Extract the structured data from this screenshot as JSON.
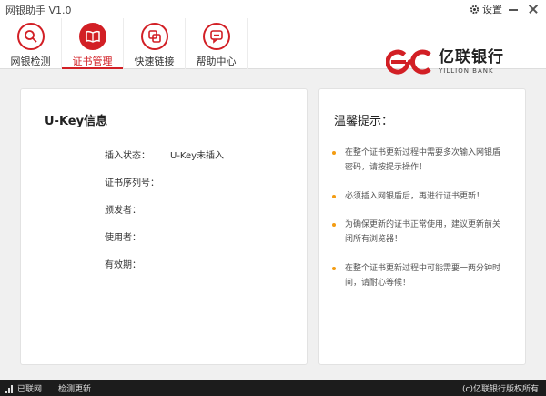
{
  "window": {
    "title": "网银助手 V1.0",
    "settings_label": "设置"
  },
  "nav": {
    "tabs": [
      {
        "label": "网银检测",
        "icon": "search-icon"
      },
      {
        "label": "证书管理",
        "icon": "book-icon",
        "active": true
      },
      {
        "label": "快速链接",
        "icon": "link-icon"
      },
      {
        "label": "帮助中心",
        "icon": "chat-icon"
      }
    ]
  },
  "brand": {
    "name_cn": "亿联银行",
    "name_en": "YILLION BANK",
    "color": "#d21f25"
  },
  "ukey": {
    "title": "U-Key信息",
    "fields": [
      {
        "label": "插入状态：",
        "value": "U-Key未插入"
      },
      {
        "label": "证书序列号：",
        "value": ""
      },
      {
        "label": "颁发者：",
        "value": ""
      },
      {
        "label": "使用者：",
        "value": ""
      },
      {
        "label": "有效期：",
        "value": ""
      }
    ]
  },
  "tips": {
    "title": "温馨提示：",
    "items": [
      "在整个证书更新过程中需要多次输入网银盾密码，请按提示操作！",
      "必须插入网银盾后，再进行证书更新！",
      "为确保更新的证书正常使用，建议更新前关闭所有浏览器！",
      "在整个证书更新过程中可能需要一两分钟时间，请耐心等候！"
    ],
    "bullet_color": "#f39c12"
  },
  "status": {
    "network": "已联网",
    "check_update": "检测更新",
    "copyright": "(c)亿联银行版权所有"
  }
}
